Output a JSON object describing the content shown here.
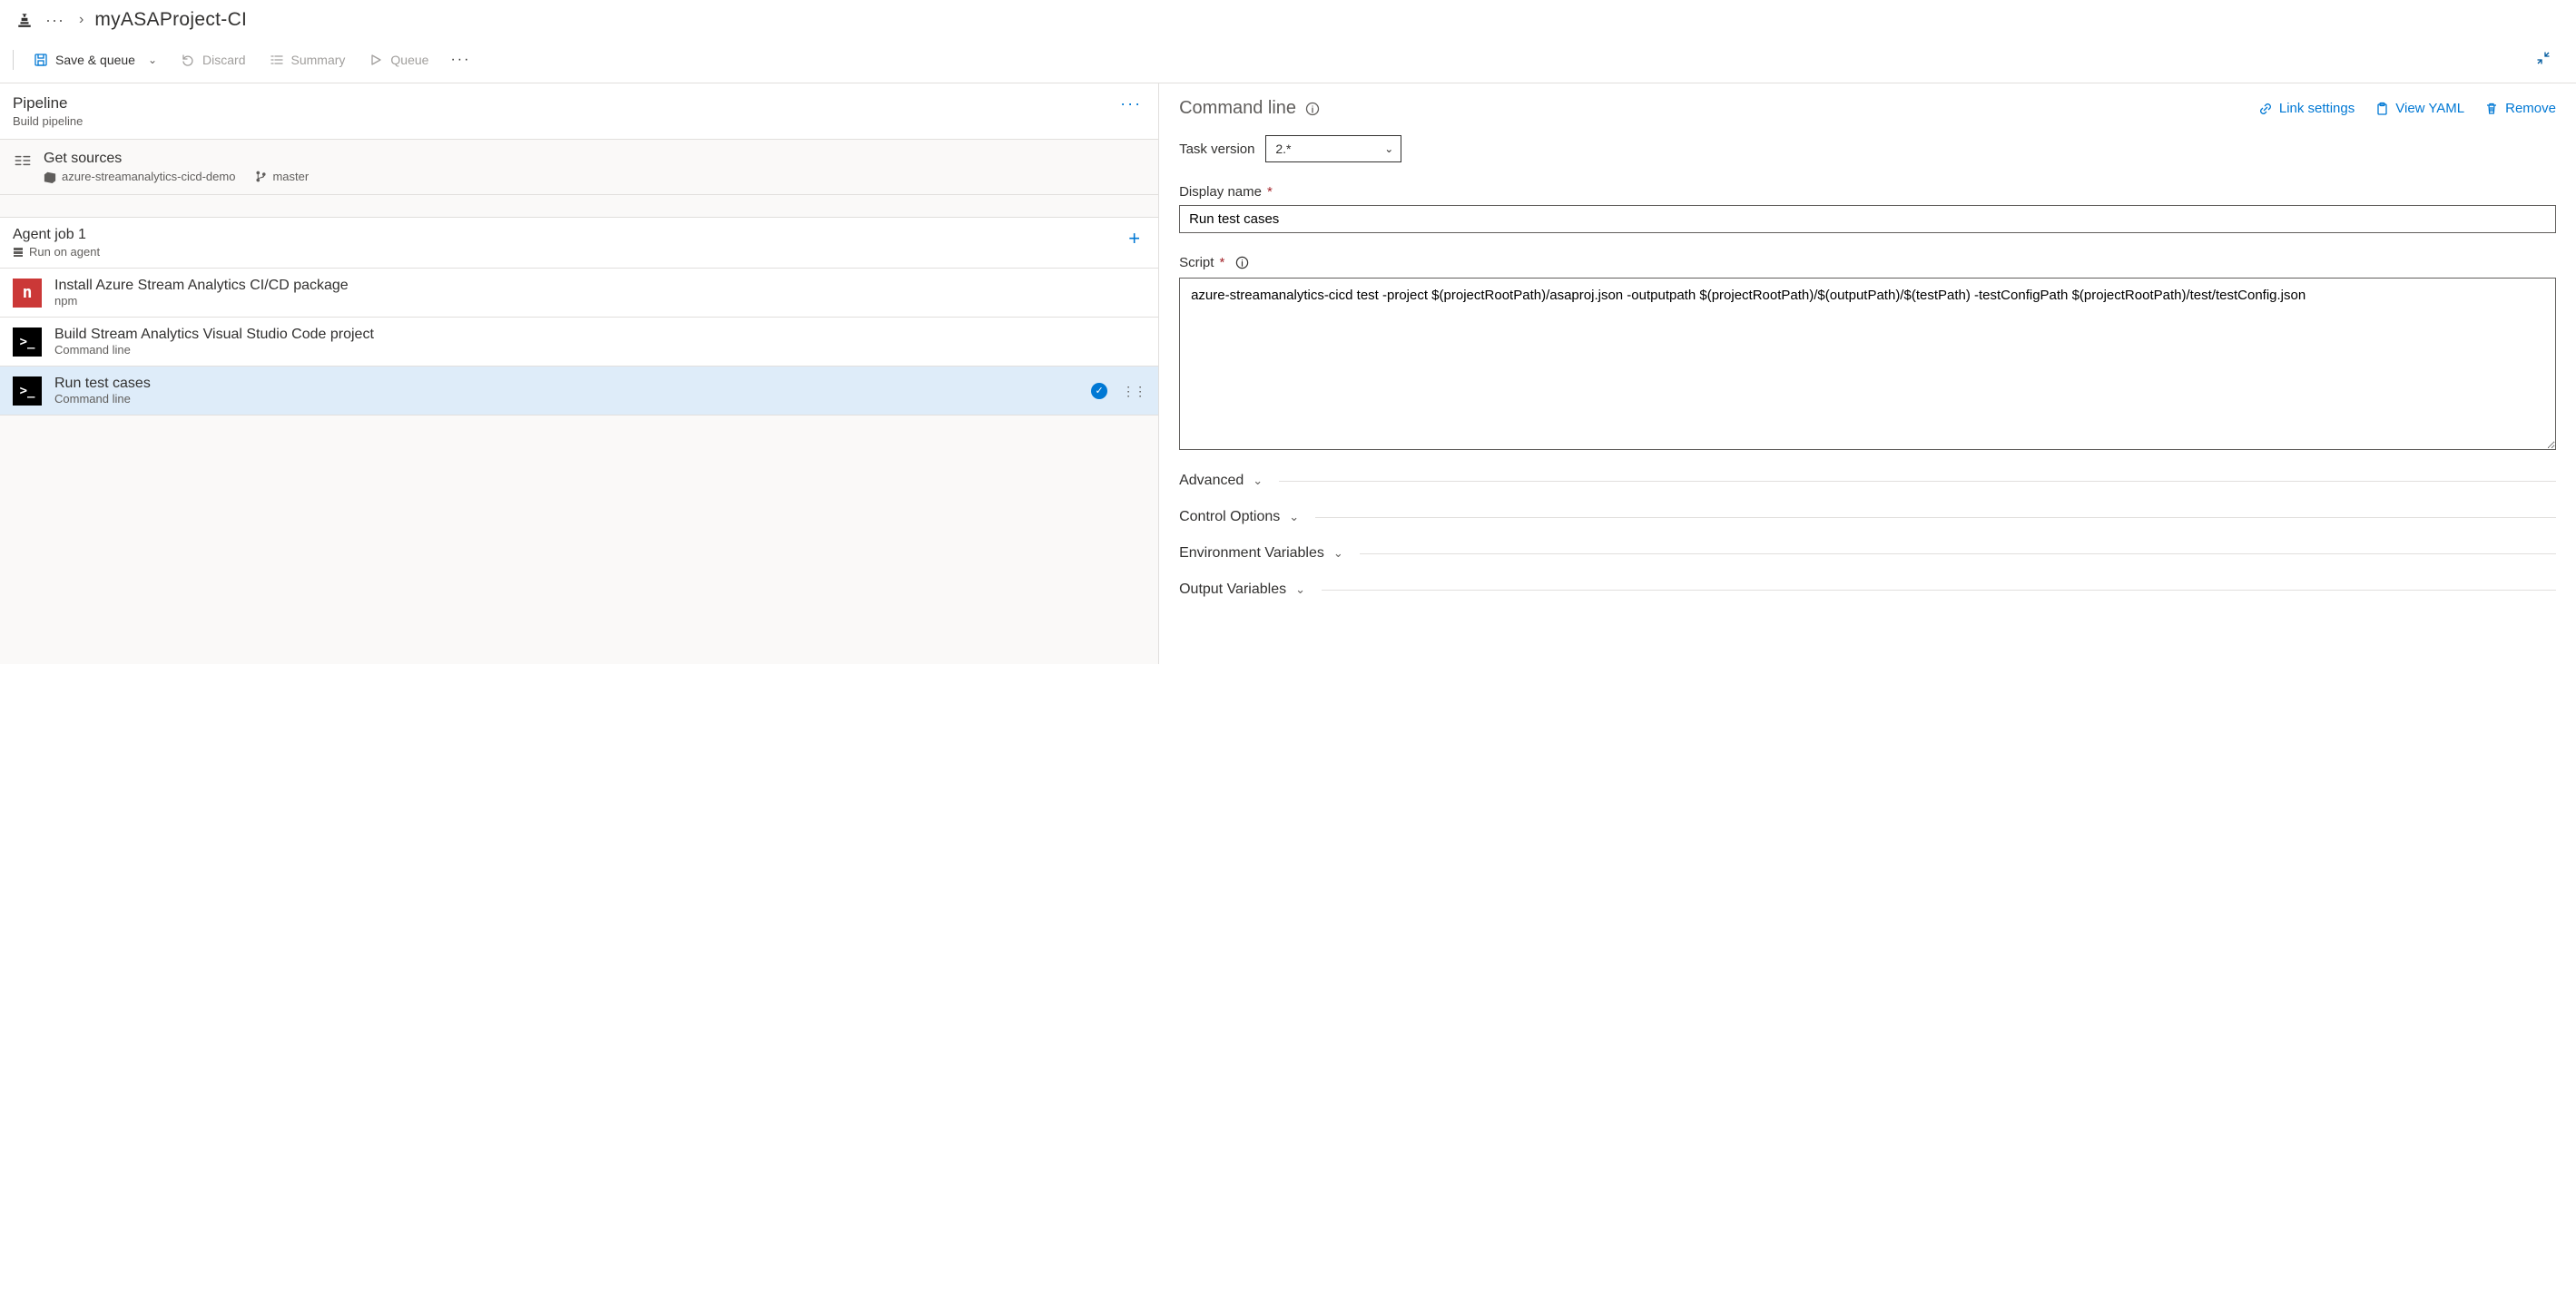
{
  "breadcrumb": {
    "ellipsis": "···",
    "title": "myASAProject-CI"
  },
  "toolbar": {
    "save_queue": "Save & queue",
    "discard": "Discard",
    "summary": "Summary",
    "queue": "Queue"
  },
  "pipeline": {
    "title": "Pipeline",
    "subtitle": "Build pipeline"
  },
  "get_sources": {
    "title": "Get sources",
    "repo": "azure-streamanalytics-cicd-demo",
    "branch": "master"
  },
  "agent_job": {
    "title": "Agent job 1",
    "subtitle": "Run on agent"
  },
  "tasks": [
    {
      "title": "Install Azure Stream Analytics CI/CD package",
      "subtitle": "npm",
      "icon": "npm"
    },
    {
      "title": "Build Stream Analytics Visual Studio Code project",
      "subtitle": "Command line",
      "icon": "cmd"
    },
    {
      "title": "Run test cases",
      "subtitle": "Command line",
      "icon": "cmd",
      "selected": true
    }
  ],
  "panel": {
    "title": "Command line",
    "link_settings": "Link settings",
    "view_yaml": "View YAML",
    "remove": "Remove",
    "task_version_label": "Task version",
    "task_version_value": "2.*",
    "display_name_label": "Display name",
    "display_name_value": "Run test cases",
    "script_label": "Script",
    "script_value": "azure-streamanalytics-cicd test -project $(projectRootPath)/asaproj.json -outputpath $(projectRootPath)/$(outputPath)/$(testPath) -testConfigPath $(projectRootPath)/test/testConfig.json",
    "sections": {
      "advanced": "Advanced",
      "control_options": "Control Options",
      "env_vars": "Environment Variables",
      "output_vars": "Output Variables"
    }
  },
  "icons": {
    "npm_glyph": "n",
    "cmd_glyph": ">_",
    "check_glyph": "✓",
    "plus": "+",
    "caret_down": "⌄",
    "dots": "···",
    "drag": "⋮⋮"
  }
}
